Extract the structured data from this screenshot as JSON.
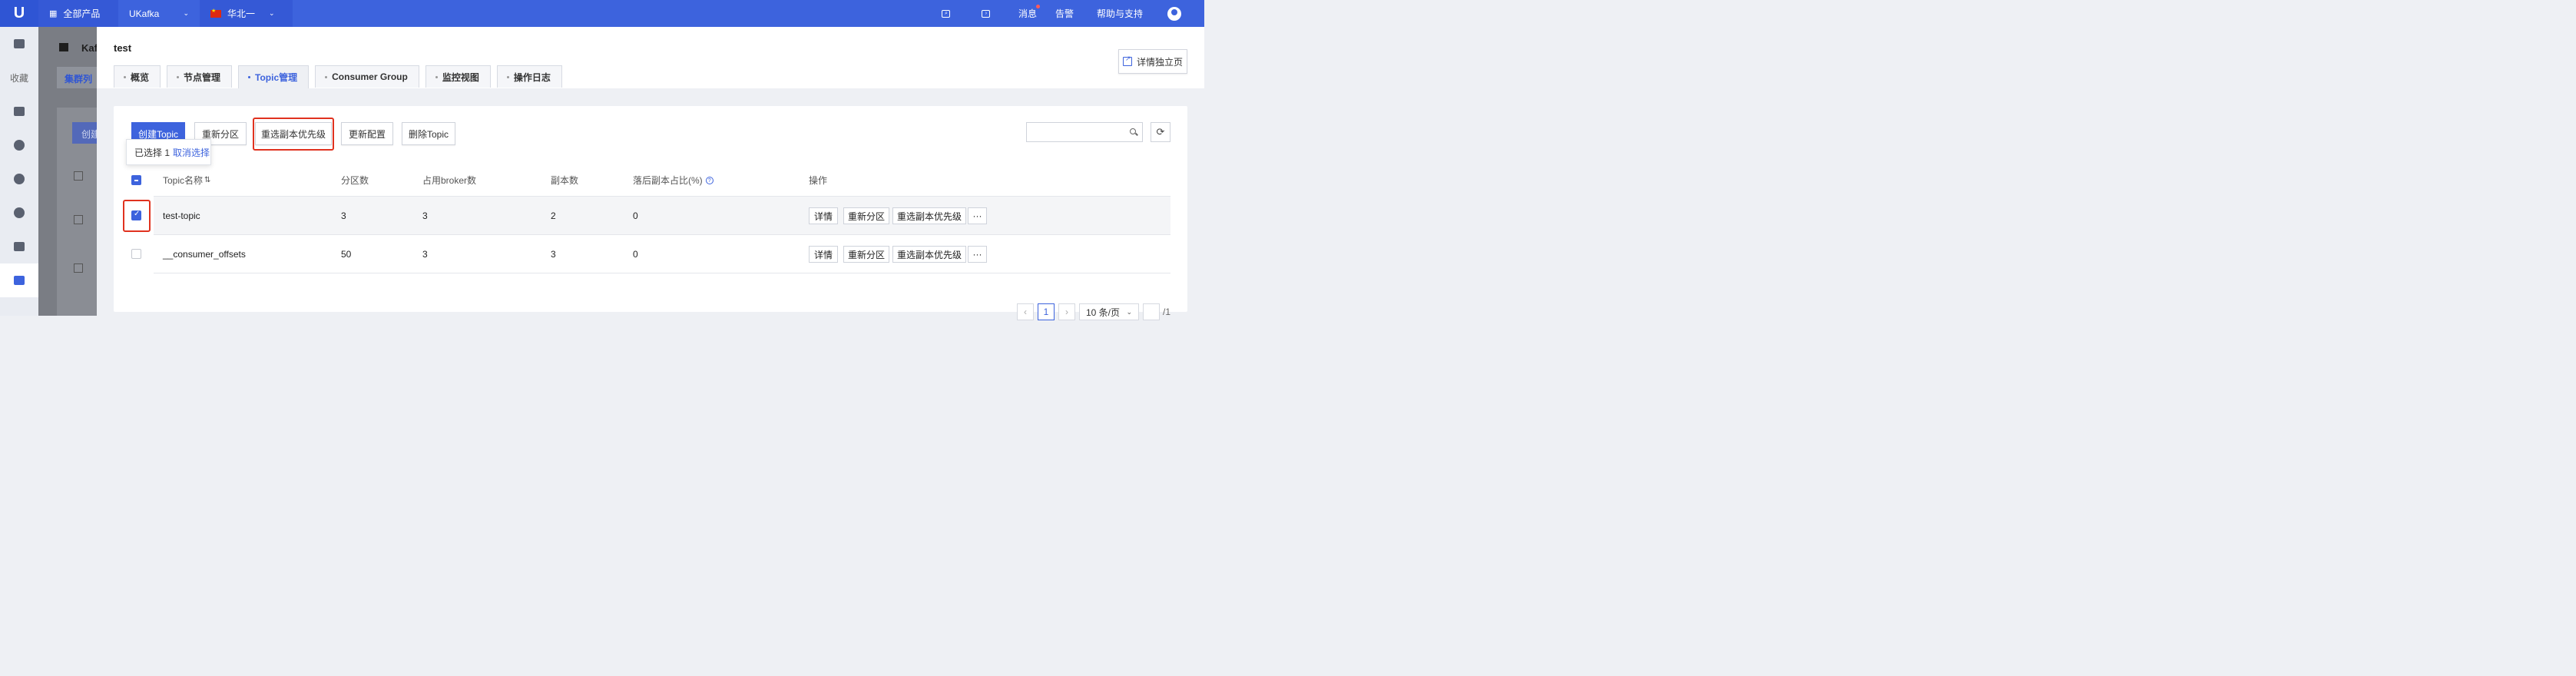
{
  "topbar": {
    "logo": "U",
    "all_products": "全部产品",
    "product": "UKafka",
    "region": "华北一",
    "messages": "消息",
    "alerts": "告警",
    "help": "帮助与支持"
  },
  "sidebar": {
    "favorites": "收藏"
  },
  "background": {
    "title": "Kaf",
    "tab": "集群列",
    "button": "创建"
  },
  "drawer": {
    "title": "test",
    "detail_page": "详情独立页",
    "tabs": [
      {
        "label": "概览"
      },
      {
        "label": "节点管理"
      },
      {
        "label": "Topic管理"
      },
      {
        "label": "Consumer Group"
      },
      {
        "label": "监控视图"
      },
      {
        "label": "操作日志"
      }
    ]
  },
  "toolbar": {
    "create": "创建Topic",
    "repartition": "重新分区",
    "reelect": "重选副本优先级",
    "update_config": "更新配置",
    "delete": "删除Topic"
  },
  "selection": {
    "text": "已选择 1",
    "cancel": "取消选择"
  },
  "table": {
    "headers": {
      "name": "Topic名称",
      "partitions": "分区数",
      "brokers": "占用broker数",
      "replicas": "副本数",
      "lag_ratio": "落后副本占比(%)",
      "ops": "操作"
    },
    "rows": [
      {
        "name": "test-topic",
        "partitions": "3",
        "brokers": "3",
        "replicas": "2",
        "lag": "0",
        "selected": true
      },
      {
        "name": "__consumer_offsets",
        "partitions": "50",
        "brokers": "3",
        "replicas": "3",
        "lag": "0",
        "selected": false
      }
    ],
    "row_ops": {
      "detail": "详情",
      "repartition": "重新分区",
      "reelect": "重选副本优先级",
      "more": "···"
    }
  },
  "pagination": {
    "prev": "‹",
    "current": "1",
    "next": "›",
    "page_size": "10 条/页",
    "total_pages": "/1"
  },
  "colors": {
    "brand": "#3d63dd",
    "highlight": "#e0321f"
  }
}
